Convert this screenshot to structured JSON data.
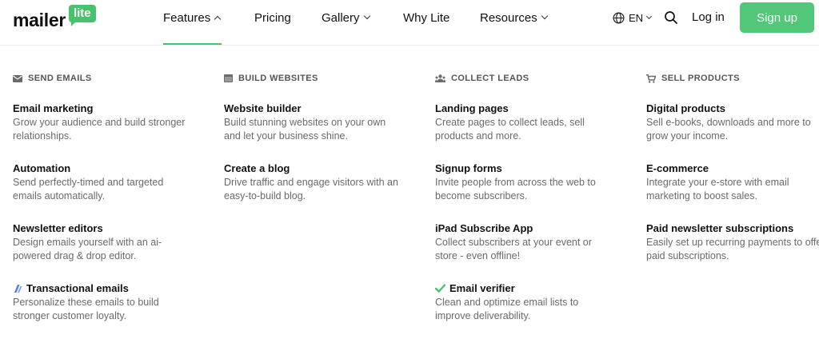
{
  "brand": {
    "name_main": "mailer",
    "name_badge": "lite",
    "accent": "#47c26d"
  },
  "nav": {
    "features": "Features",
    "pricing": "Pricing",
    "gallery": "Gallery",
    "why_lite": "Why Lite",
    "resources": "Resources",
    "language": "EN",
    "login": "Log in",
    "signup": "Sign up"
  },
  "columns": [
    {
      "heading": "SEND EMAILS",
      "icon": "envelope-icon",
      "items": [
        {
          "title": "Email marketing",
          "desc": "Grow your audience and build stronger relationships."
        },
        {
          "title": "Automation",
          "desc": "Send perfectly-timed and targeted emails automatically."
        },
        {
          "title": "Newsletter editors",
          "desc": "Design emails yourself with an ai-powered drag & drop editor."
        },
        {
          "title": "Transactional emails",
          "desc": "Personalize these emails to build stronger customer loyalty.",
          "icon": "transactional-icon"
        }
      ]
    },
    {
      "heading": "BUILD WEBSITES",
      "icon": "browser-window-icon",
      "items": [
        {
          "title": "Website builder",
          "desc": "Build stunning websites on your own and let your business shine."
        },
        {
          "title": "Create a blog",
          "desc": "Drive traffic and engage visitors with an easy-to-build blog."
        }
      ]
    },
    {
      "heading": "COLLECT LEADS",
      "icon": "people-icon",
      "items": [
        {
          "title": "Landing pages",
          "desc": "Create pages to collect leads, sell products and more."
        },
        {
          "title": "Signup forms",
          "desc": "Invite people from across the web to become subscribers."
        },
        {
          "title": "iPad Subscribe App",
          "desc": "Collect subscribers at your event or store - even offline!"
        },
        {
          "title": "Email verifier",
          "desc": "Clean and optimize email lists to improve deliverability.",
          "icon": "checkmark-icon"
        }
      ]
    },
    {
      "heading": "SELL PRODUCTS",
      "icon": "cart-icon",
      "items": [
        {
          "title": "Digital products",
          "desc": "Sell e-books, downloads and more to grow your income."
        },
        {
          "title": "E-commerce",
          "desc": "Integrate your e-store with email marketing to boost sales."
        },
        {
          "title": "Paid newsletter subscriptions",
          "desc": "Easily set up recurring payments to offer paid subscriptions."
        }
      ]
    }
  ]
}
